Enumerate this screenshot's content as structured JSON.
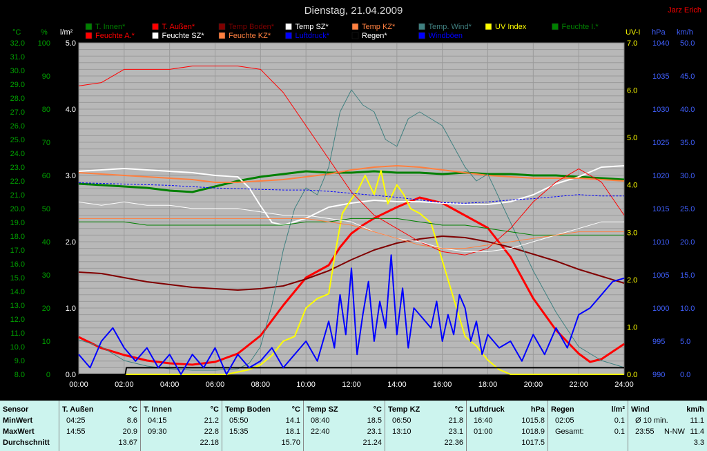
{
  "chart_data": {
    "type": "line",
    "title": "Dienstag, 21.04.2009",
    "author": "Jarz Erich",
    "x_ticks": [
      "00:00",
      "02:00",
      "04:00",
      "06:00",
      "08:00",
      "10:00",
      "12:00",
      "14:00",
      "16:00",
      "18:00",
      "20:00",
      "22:00",
      "24:00"
    ],
    "axes": {
      "temp_c": {
        "label": "°C",
        "min": 8.0,
        "max": 32.0,
        "step": 1,
        "color": "#008000"
      },
      "hum_pct": {
        "label": "%",
        "min": 0,
        "max": 100,
        "step": 10,
        "color": "#008000"
      },
      "rain_lm2": {
        "label": "l/m²",
        "min": 0.0,
        "max": 5.0,
        "step": 1,
        "color": "#000000"
      },
      "uv": {
        "label": "UV-I",
        "min": 0.0,
        "max": 7.0,
        "step": 1,
        "color": "#ffff00"
      },
      "press_hpa": {
        "label": "hPa",
        "min": 990,
        "max": 1040,
        "step": 5,
        "color": "#0000ff"
      },
      "wind_kmh": {
        "label": "km/h",
        "min": 0.0,
        "max": 50.0,
        "step": 5,
        "color": "#0000ff"
      }
    },
    "legend": [
      {
        "name": "T. Innen*",
        "color": "#008000"
      },
      {
        "name": "T. Außen*",
        "color": "#ff0000"
      },
      {
        "name": "Temp Boden*",
        "color": "#800000"
      },
      {
        "name": "Temp SZ*",
        "color": "#ffffff"
      },
      {
        "name": "Temp KZ*",
        "color": "#ff8040"
      },
      {
        "name": "Temp. Wind*",
        "color": "#408080"
      },
      {
        "name": "UV Index",
        "color": "#ffff00"
      },
      {
        "name": "Feuchte I.*",
        "color": "#008000"
      },
      {
        "name": "Feuchte A.*",
        "color": "#ff0000"
      },
      {
        "name": "Feuchte SZ*",
        "color": "#ffffff"
      },
      {
        "name": "Feuchte KZ*",
        "color": "#ff8040"
      },
      {
        "name": "Luftdruck*",
        "color": "#0000ff"
      },
      {
        "name": "Regen*",
        "color": "#000000"
      },
      {
        "name": "Windböen",
        "color": "#0000ff"
      }
    ],
    "series": [
      {
        "name": "T. Innen*",
        "axis": "temp_c",
        "color": "#008000",
        "width": 3,
        "x": [
          0,
          1,
          2,
          3,
          4,
          5,
          6,
          7,
          8,
          9,
          10,
          11,
          12,
          13,
          14,
          15,
          16,
          17,
          18,
          19,
          20,
          21,
          22,
          23,
          24
        ],
        "values": [
          21.8,
          21.7,
          21.6,
          21.5,
          21.3,
          21.2,
          21.6,
          22.0,
          22.3,
          22.5,
          22.7,
          22.6,
          22.6,
          22.7,
          22.6,
          22.6,
          22.5,
          22.6,
          22.5,
          22.5,
          22.4,
          22.4,
          22.3,
          22.2,
          22.1
        ]
      },
      {
        "name": "T. Außen*",
        "axis": "temp_c",
        "color": "#ff0000",
        "width": 3,
        "x": [
          0,
          1,
          2,
          3,
          4,
          5,
          6,
          7,
          8,
          9,
          10,
          11,
          11.5,
          12,
          12.5,
          13,
          14,
          15,
          16,
          17,
          18,
          19,
          20,
          21,
          22,
          22.5,
          23,
          24
        ],
        "values": [
          10.7,
          9.9,
          9.4,
          9.0,
          8.8,
          8.7,
          8.9,
          9.5,
          10.8,
          13.0,
          15.0,
          15.9,
          17.2,
          18.2,
          18.8,
          19.3,
          20.1,
          20.8,
          20.4,
          19.5,
          18.6,
          16.5,
          13.5,
          11.2,
          9.5,
          8.9,
          9.1,
          10.2
        ]
      },
      {
        "name": "Temp Boden*",
        "axis": "temp_c",
        "color": "#800000",
        "width": 2,
        "x": [
          0,
          1,
          2,
          3,
          4,
          5,
          6,
          7,
          8,
          9,
          10,
          11,
          12,
          13,
          14,
          15,
          16,
          17,
          18,
          19,
          20,
          21,
          22,
          23,
          24
        ],
        "values": [
          15.4,
          15.3,
          15.0,
          14.7,
          14.5,
          14.3,
          14.2,
          14.1,
          14.2,
          14.4,
          14.9,
          15.5,
          16.3,
          17.0,
          17.5,
          17.8,
          18.0,
          17.9,
          17.6,
          17.2,
          16.7,
          16.2,
          15.6,
          15.1,
          14.6
        ]
      },
      {
        "name": "Temp SZ*",
        "axis": "temp_c",
        "color": "#ffffff",
        "width": 2,
        "x": [
          0,
          1,
          2,
          3,
          4,
          5,
          6,
          7,
          7.5,
          8,
          8.5,
          9,
          10,
          11,
          12,
          13,
          14,
          15,
          16,
          17,
          18,
          19,
          20,
          21,
          22,
          23,
          24
        ],
        "values": [
          22.7,
          22.8,
          22.9,
          22.8,
          22.7,
          22.6,
          22.4,
          22.3,
          21.5,
          20.2,
          19.0,
          18.8,
          19.3,
          20.1,
          20.4,
          20.6,
          20.5,
          20.5,
          20.4,
          20.3,
          20.3,
          20.5,
          21.0,
          21.8,
          22.3,
          23.0,
          23.1
        ]
      },
      {
        "name": "Temp KZ*",
        "axis": "temp_c",
        "color": "#ff8040",
        "width": 2,
        "x": [
          0,
          1,
          2,
          3,
          4,
          5,
          6,
          7,
          8,
          9,
          10,
          11,
          12,
          13,
          14,
          15,
          16,
          17,
          18,
          19,
          20,
          21,
          22,
          23,
          24
        ],
        "values": [
          22.6,
          22.5,
          22.4,
          22.3,
          22.2,
          22.1,
          21.9,
          21.9,
          22.0,
          22.1,
          22.3,
          22.5,
          22.8,
          23.0,
          23.1,
          23.0,
          22.8,
          22.6,
          22.4,
          22.3,
          22.2,
          22.2,
          22.2,
          22.1,
          22.0
        ]
      },
      {
        "name": "Temp. Wind*",
        "axis": "temp_c",
        "color": "#408080",
        "width": 1,
        "x": [
          0,
          1,
          2,
          3,
          4,
          5,
          6,
          7,
          7.5,
          8,
          8.5,
          9,
          9.5,
          10,
          10.5,
          11,
          11.5,
          12,
          12.5,
          13,
          13.5,
          14,
          14.5,
          15,
          15.5,
          16,
          16.5,
          17,
          17.5,
          18,
          19,
          20,
          21,
          22,
          23,
          24
        ],
        "values": [
          10.5,
          10.0,
          9.0,
          8.6,
          8.4,
          8.3,
          8.3,
          8.4,
          8.8,
          10.0,
          13.0,
          17.0,
          20.0,
          21.5,
          21.0,
          23.0,
          27.0,
          28.6,
          27.5,
          27.0,
          25.0,
          24.5,
          26.5,
          27.0,
          26.5,
          26.0,
          24.5,
          23.0,
          22.0,
          22.5,
          19.0,
          15.5,
          12.5,
          10.0,
          9.0,
          8.5
        ]
      },
      {
        "name": "UV Index",
        "axis": "uv",
        "color": "#ffff00",
        "width": 2,
        "x": [
          0,
          6.5,
          7,
          7.5,
          8,
          8.5,
          9,
          9.5,
          10,
          10.5,
          11,
          11.3,
          11.6,
          12,
          12.3,
          12.6,
          13,
          13.3,
          13.6,
          14,
          14.3,
          14.6,
          15,
          15.5,
          16,
          16.5,
          17,
          17.5,
          18,
          18.5,
          19,
          24
        ],
        "values": [
          0,
          0,
          0.05,
          0.1,
          0.2,
          0.4,
          0.7,
          0.8,
          1.4,
          1.6,
          1.7,
          2.6,
          3.4,
          3.7,
          3.9,
          4.2,
          3.8,
          4.3,
          3.6,
          4.0,
          3.8,
          3.5,
          3.4,
          3.2,
          2.4,
          1.6,
          0.8,
          0.6,
          0.3,
          0.1,
          0,
          0
        ]
      },
      {
        "name": "Feuchte I.*",
        "axis": "hum_pct",
        "color": "#008000",
        "width": 1,
        "x": [
          0,
          1,
          2,
          3,
          4,
          5,
          6,
          7,
          8,
          9,
          10,
          11,
          12,
          13,
          14,
          15,
          16,
          17,
          18,
          19,
          20,
          21,
          22,
          23,
          24
        ],
        "values": [
          46,
          46,
          46,
          45,
          45,
          45,
          45,
          45,
          45,
          45,
          46,
          46,
          47,
          47,
          47,
          46,
          45,
          45,
          44,
          43,
          42,
          42,
          42,
          42,
          42
        ]
      },
      {
        "name": "Feuchte A.*",
        "axis": "hum_pct",
        "color": "#ff0000",
        "width": 1,
        "x": [
          0,
          1,
          2,
          3,
          4,
          5,
          6,
          7,
          8,
          9,
          10,
          11,
          12,
          13,
          14,
          15,
          16,
          17,
          18,
          19,
          20,
          21,
          22,
          23,
          24
        ],
        "values": [
          87,
          88,
          92,
          92,
          92,
          93,
          93,
          93,
          92,
          85,
          75,
          65,
          55,
          48,
          44,
          40,
          37,
          36,
          38,
          44,
          52,
          58,
          62,
          58,
          48
        ]
      },
      {
        "name": "Feuchte SZ*",
        "axis": "hum_pct",
        "color": "#ffffff",
        "width": 1,
        "x": [
          0,
          1,
          2,
          3,
          4,
          5,
          6,
          7,
          8,
          9,
          10,
          11,
          12,
          13,
          14,
          15,
          16,
          17,
          18,
          19,
          20,
          21,
          22,
          23,
          24
        ],
        "values": [
          52,
          51,
          52,
          51,
          51,
          50,
          50,
          50,
          49,
          48,
          48,
          47,
          46,
          43,
          41,
          40,
          38,
          37,
          37,
          38,
          40,
          42,
          44,
          46,
          46
        ]
      },
      {
        "name": "Feuchte KZ*",
        "axis": "hum_pct",
        "color": "#ff8040",
        "width": 1,
        "x": [
          0,
          1,
          2,
          3,
          4,
          5,
          6,
          7,
          8,
          9,
          10,
          11,
          12,
          13,
          14,
          15,
          16,
          17,
          18,
          19,
          20,
          21,
          22,
          23,
          24
        ],
        "values": [
          47,
          47,
          47,
          47,
          47,
          47,
          47,
          47,
          47,
          47,
          47,
          46,
          45,
          43,
          41,
          39,
          38,
          38,
          39,
          40,
          41,
          42,
          43,
          43,
          43
        ]
      },
      {
        "name": "Luftdruck*",
        "axis": "press_hpa",
        "color": "#0000ff",
        "width": 1,
        "dashed": true,
        "x": [
          0,
          1,
          2,
          3,
          4,
          5,
          6,
          7,
          8,
          9,
          10,
          11,
          12,
          13,
          14,
          15,
          16,
          17,
          18,
          19,
          20,
          21,
          22,
          23,
          24
        ],
        "values": [
          1018.9,
          1018.8,
          1018.7,
          1018.6,
          1018.5,
          1018.3,
          1018.1,
          1018.0,
          1017.9,
          1017.8,
          1017.8,
          1017.6,
          1017.3,
          1017.0,
          1016.7,
          1016.3,
          1015.9,
          1015.8,
          1016.0,
          1016.3,
          1016.5,
          1016.8,
          1017.1,
          1016.9,
          1016.9
        ]
      },
      {
        "name": "Regen*",
        "axis": "rain_lm2",
        "color": "#000000",
        "width": 2,
        "x": [
          0,
          2.05,
          2.1,
          24
        ],
        "values": [
          0,
          0,
          0.1,
          0.1
        ]
      },
      {
        "name": "Windböen",
        "axis": "wind_kmh",
        "color": "#0000ff",
        "width": 2,
        "x": [
          0,
          0.5,
          1,
          1.5,
          2,
          2.5,
          3,
          3.5,
          4,
          4.5,
          5,
          5.5,
          6,
          6.5,
          7,
          7.5,
          8,
          8.5,
          9,
          9.5,
          10,
          10.5,
          11,
          11.25,
          11.5,
          11.75,
          12,
          12.25,
          12.5,
          12.75,
          13,
          13.25,
          13.5,
          13.75,
          14,
          14.25,
          14.5,
          14.75,
          15,
          15.25,
          15.5,
          15.75,
          16,
          16.25,
          16.5,
          16.75,
          17,
          17.25,
          17.5,
          17.75,
          18,
          18.5,
          19,
          19.5,
          20,
          20.5,
          21,
          21.5,
          22,
          22.5,
          23,
          23.5,
          24
        ],
        "values": [
          3,
          1,
          5,
          7,
          4,
          2,
          4,
          1,
          3,
          0,
          3,
          1,
          4,
          0,
          3,
          1,
          2,
          4,
          1,
          3,
          5,
          2,
          8,
          4,
          12,
          6,
          16,
          3,
          9,
          14,
          5,
          11,
          7,
          18,
          6,
          13,
          4,
          10,
          9,
          8,
          7,
          11,
          5,
          9,
          6,
          12,
          10,
          5,
          8,
          3,
          6,
          4,
          5,
          2,
          6,
          3,
          7,
          4,
          9,
          10,
          12,
          14,
          14.5
        ]
      }
    ]
  },
  "stats": {
    "sensor_label": "Sensor",
    "row_labels": [
      "MinWert",
      "MaxWert",
      "Durchschnitt"
    ],
    "columns": [
      {
        "title": "T. Außen",
        "unit": "°C",
        "rows": [
          [
            "04:25",
            "8.6"
          ],
          [
            "14:55",
            "20.9"
          ],
          [
            "",
            "13.67"
          ]
        ]
      },
      {
        "title": "T. Innen",
        "unit": "°C",
        "rows": [
          [
            "04:15",
            "21.2"
          ],
          [
            "09:30",
            "22.8"
          ],
          [
            "",
            "22.18"
          ]
        ]
      },
      {
        "title": "Temp Boden",
        "unit": "°C",
        "rows": [
          [
            "05:50",
            "14.1"
          ],
          [
            "15:35",
            "18.1"
          ],
          [
            "",
            "15.70"
          ]
        ]
      },
      {
        "title": "Temp SZ",
        "unit": "°C",
        "rows": [
          [
            "08:40",
            "18.5"
          ],
          [
            "22:40",
            "23.1"
          ],
          [
            "",
            "21.24"
          ]
        ]
      },
      {
        "title": "Temp KZ",
        "unit": "°C",
        "rows": [
          [
            "06:50",
            "21.8"
          ],
          [
            "13:10",
            "23.1"
          ],
          [
            "",
            "22.36"
          ]
        ]
      },
      {
        "title": "Luftdruck",
        "unit": "hPa",
        "rows": [
          [
            "16:40",
            "1015.8"
          ],
          [
            "01:00",
            "1018.9"
          ],
          [
            "",
            "1017.5"
          ]
        ]
      },
      {
        "title": "Regen",
        "unit": "l/m²",
        "rows": [
          [
            "02:05",
            "0.1"
          ],
          [
            "Gesamt:",
            "0.1"
          ],
          [
            "",
            ""
          ]
        ]
      },
      {
        "title": "Wind",
        "unit": "km/h",
        "rows": [
          [
            "Ø 10 min.",
            "11.1"
          ],
          [
            "23:55",
            "11.4"
          ],
          [
            "",
            "3.3"
          ]
        ],
        "mid": [
          "",
          "N-NW",
          ""
        ]
      }
    ]
  }
}
